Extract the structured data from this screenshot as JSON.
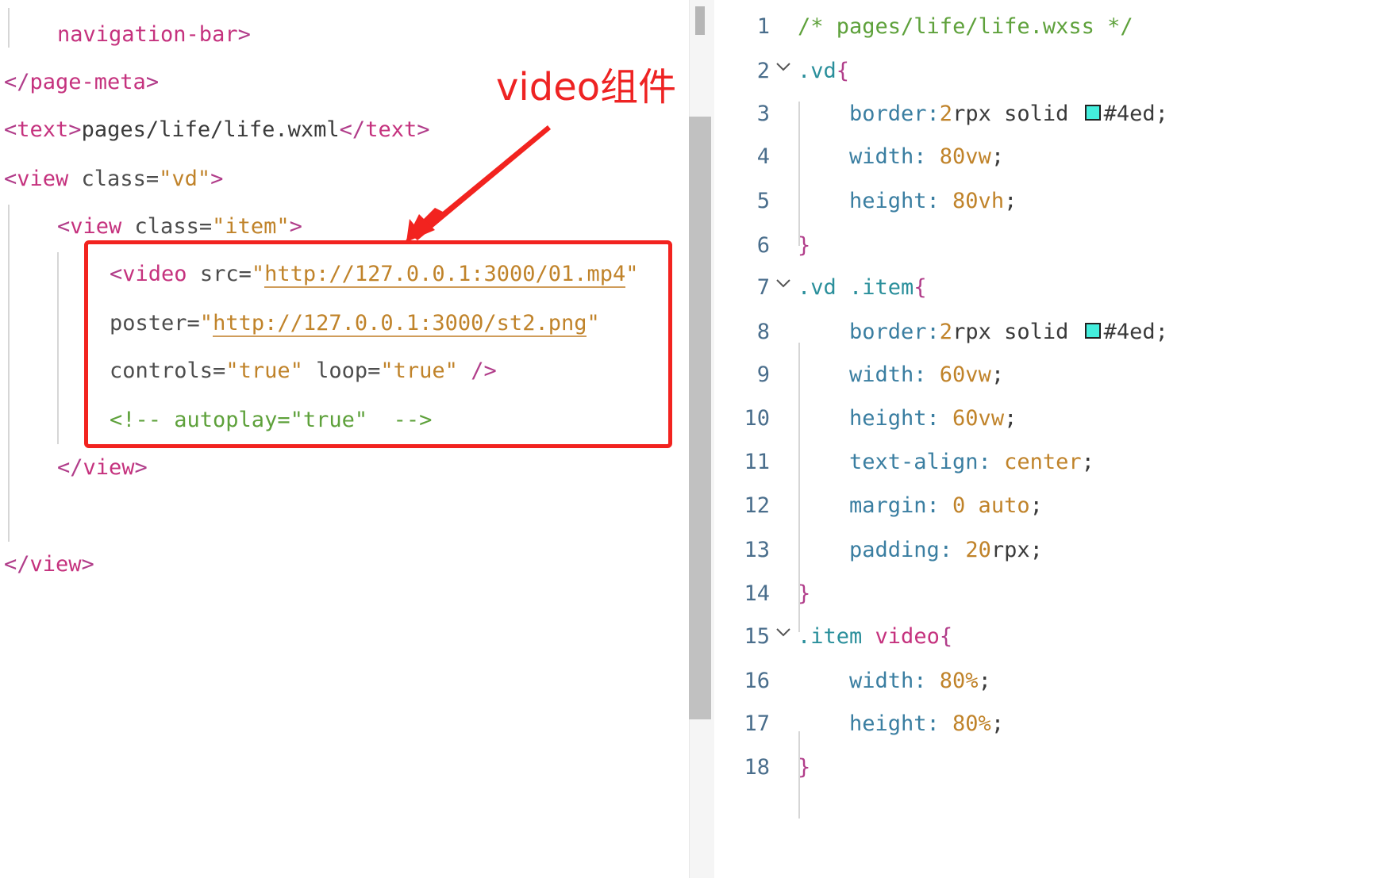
{
  "wxml": {
    "lines": [
      {
        "parts": [
          {
            "cls": "tag",
            "text": "navigation-bar"
          },
          {
            "cls": "tag-bracket",
            "text": ">"
          }
        ]
      },
      {
        "parts": [
          {
            "cls": "tag-bracket",
            "text": "</"
          },
          {
            "cls": "tag",
            "text": "page-meta"
          },
          {
            "cls": "tag-bracket",
            "text": ">"
          }
        ]
      },
      {
        "parts": [
          {
            "cls": "tag-bracket",
            "text": "<"
          },
          {
            "cls": "tag",
            "text": "text"
          },
          {
            "cls": "tag-bracket",
            "text": ">"
          },
          {
            "cls": "plain",
            "text": "pages/life/life.wxml"
          },
          {
            "cls": "tag-bracket",
            "text": "</"
          },
          {
            "cls": "tag",
            "text": "text"
          },
          {
            "cls": "tag-bracket",
            "text": ">"
          }
        ]
      },
      {
        "parts": [
          {
            "cls": "tag-bracket",
            "text": "<"
          },
          {
            "cls": "tag",
            "text": "view "
          },
          {
            "cls": "attr",
            "text": "class="
          },
          {
            "cls": "str",
            "text": "\"vd\""
          },
          {
            "cls": "tag-bracket",
            "text": ">"
          }
        ]
      },
      {
        "parts": [
          {
            "cls": "tag-bracket",
            "text": "<"
          },
          {
            "cls": "tag",
            "text": "view "
          },
          {
            "cls": "attr",
            "text": "class="
          },
          {
            "cls": "str",
            "text": "\"item\""
          },
          {
            "cls": "tag-bracket",
            "text": ">"
          }
        ]
      },
      {
        "parts": [
          {
            "cls": "tag-bracket",
            "text": "<"
          },
          {
            "cls": "tag",
            "text": "video "
          },
          {
            "cls": "attr",
            "text": "src="
          },
          {
            "cls": "str",
            "text": "\""
          },
          {
            "cls": "url",
            "text": "http://127.0.0.1:3000/01.mp4"
          },
          {
            "cls": "str",
            "text": "\""
          }
        ]
      },
      {
        "parts": [
          {
            "cls": "attr",
            "text": "poster="
          },
          {
            "cls": "str",
            "text": "\""
          },
          {
            "cls": "url",
            "text": "http://127.0.0.1:3000/st2.png"
          },
          {
            "cls": "str",
            "text": "\""
          }
        ]
      },
      {
        "parts": [
          {
            "cls": "attr",
            "text": "controls="
          },
          {
            "cls": "str",
            "text": "\"true\""
          },
          {
            "cls": "attr",
            "text": " loop="
          },
          {
            "cls": "str",
            "text": "\"true\""
          },
          {
            "cls": "tag-bracket",
            "text": " />"
          }
        ]
      },
      {
        "parts": [
          {
            "cls": "comment",
            "text": "<!-- autoplay=\"true\"  -->"
          }
        ]
      },
      {
        "parts": [
          {
            "cls": "tag-bracket",
            "text": "</"
          },
          {
            "cls": "tag",
            "text": "view"
          },
          {
            "cls": "tag-bracket",
            "text": ">"
          }
        ]
      },
      {
        "parts": [
          {
            "cls": "tag-bracket",
            "text": "</"
          },
          {
            "cls": "tag",
            "text": "view"
          },
          {
            "cls": "tag-bracket",
            "text": ">"
          }
        ]
      }
    ]
  },
  "annotation": {
    "label": "video组件",
    "color": "#f2231f"
  },
  "wxss": {
    "lines": [
      {
        "num": "1",
        "fold": false,
        "parts": [
          {
            "cls": "css-comment",
            "text": "/* pages/life/life.wxss */"
          }
        ]
      },
      {
        "num": "2",
        "fold": true,
        "parts": [
          {
            "cls": "css-sel",
            "text": ".vd"
          },
          {
            "cls": "css-brace",
            "text": "{"
          }
        ]
      },
      {
        "num": "3",
        "fold": false,
        "parts": [
          {
            "cls": "css-prop",
            "text": "border:"
          },
          {
            "cls": "css-val",
            "text": "2"
          },
          {
            "cls": "css-plain",
            "text": "rpx solid "
          },
          {
            "cls": "swatch",
            "text": ""
          },
          {
            "cls": "css-plain",
            "text": "#4ed;"
          }
        ]
      },
      {
        "num": "4",
        "fold": false,
        "parts": [
          {
            "cls": "css-prop",
            "text": "width: "
          },
          {
            "cls": "css-val",
            "text": "80vw"
          },
          {
            "cls": "css-plain",
            "text": ";"
          }
        ]
      },
      {
        "num": "5",
        "fold": false,
        "parts": [
          {
            "cls": "css-prop",
            "text": "height: "
          },
          {
            "cls": "css-val",
            "text": "80vh"
          },
          {
            "cls": "css-plain",
            "text": ";"
          }
        ]
      },
      {
        "num": "6",
        "fold": false,
        "parts": [
          {
            "cls": "css-brace",
            "text": "}"
          }
        ]
      },
      {
        "num": "7",
        "fold": true,
        "parts": [
          {
            "cls": "css-sel",
            "text": ".vd .item"
          },
          {
            "cls": "css-brace",
            "text": "{"
          }
        ]
      },
      {
        "num": "8",
        "fold": false,
        "parts": [
          {
            "cls": "css-prop",
            "text": "border:"
          },
          {
            "cls": "css-val",
            "text": "2"
          },
          {
            "cls": "css-plain",
            "text": "rpx solid "
          },
          {
            "cls": "swatch",
            "text": ""
          },
          {
            "cls": "css-plain",
            "text": "#4ed;"
          }
        ]
      },
      {
        "num": "9",
        "fold": false,
        "parts": [
          {
            "cls": "css-prop",
            "text": "width: "
          },
          {
            "cls": "css-val",
            "text": "60vw"
          },
          {
            "cls": "css-plain",
            "text": ";"
          }
        ]
      },
      {
        "num": "10",
        "fold": false,
        "parts": [
          {
            "cls": "css-prop",
            "text": "height: "
          },
          {
            "cls": "css-val",
            "text": "60vw"
          },
          {
            "cls": "css-plain",
            "text": ";"
          }
        ]
      },
      {
        "num": "11",
        "fold": false,
        "parts": [
          {
            "cls": "css-prop",
            "text": "text-align: "
          },
          {
            "cls": "css-val",
            "text": "center"
          },
          {
            "cls": "css-plain",
            "text": ";"
          }
        ]
      },
      {
        "num": "12",
        "fold": false,
        "parts": [
          {
            "cls": "css-prop",
            "text": "margin: "
          },
          {
            "cls": "css-val",
            "text": "0 auto"
          },
          {
            "cls": "css-plain",
            "text": ";"
          }
        ]
      },
      {
        "num": "13",
        "fold": false,
        "parts": [
          {
            "cls": "css-prop",
            "text": "padding: "
          },
          {
            "cls": "css-val",
            "text": "20"
          },
          {
            "cls": "css-plain",
            "text": "rpx;"
          }
        ]
      },
      {
        "num": "14",
        "fold": false,
        "parts": [
          {
            "cls": "css-brace",
            "text": "}"
          }
        ]
      },
      {
        "num": "15",
        "fold": true,
        "parts": [
          {
            "cls": "css-sel",
            "text": ".item "
          },
          {
            "cls": "css-sel-tag",
            "text": "video"
          },
          {
            "cls": "css-brace",
            "text": "{"
          }
        ]
      },
      {
        "num": "16",
        "fold": false,
        "parts": [
          {
            "cls": "css-prop",
            "text": "width: "
          },
          {
            "cls": "css-val",
            "text": "80%"
          },
          {
            "cls": "css-plain",
            "text": ";"
          }
        ]
      },
      {
        "num": "17",
        "fold": false,
        "parts": [
          {
            "cls": "css-prop",
            "text": "height: "
          },
          {
            "cls": "css-val",
            "text": "80%"
          },
          {
            "cls": "css-plain",
            "text": ";"
          }
        ]
      },
      {
        "num": "18",
        "fold": false,
        "parts": [
          {
            "cls": "css-brace",
            "text": "}"
          }
        ]
      }
    ],
    "swatch_color": "#44eedd"
  }
}
